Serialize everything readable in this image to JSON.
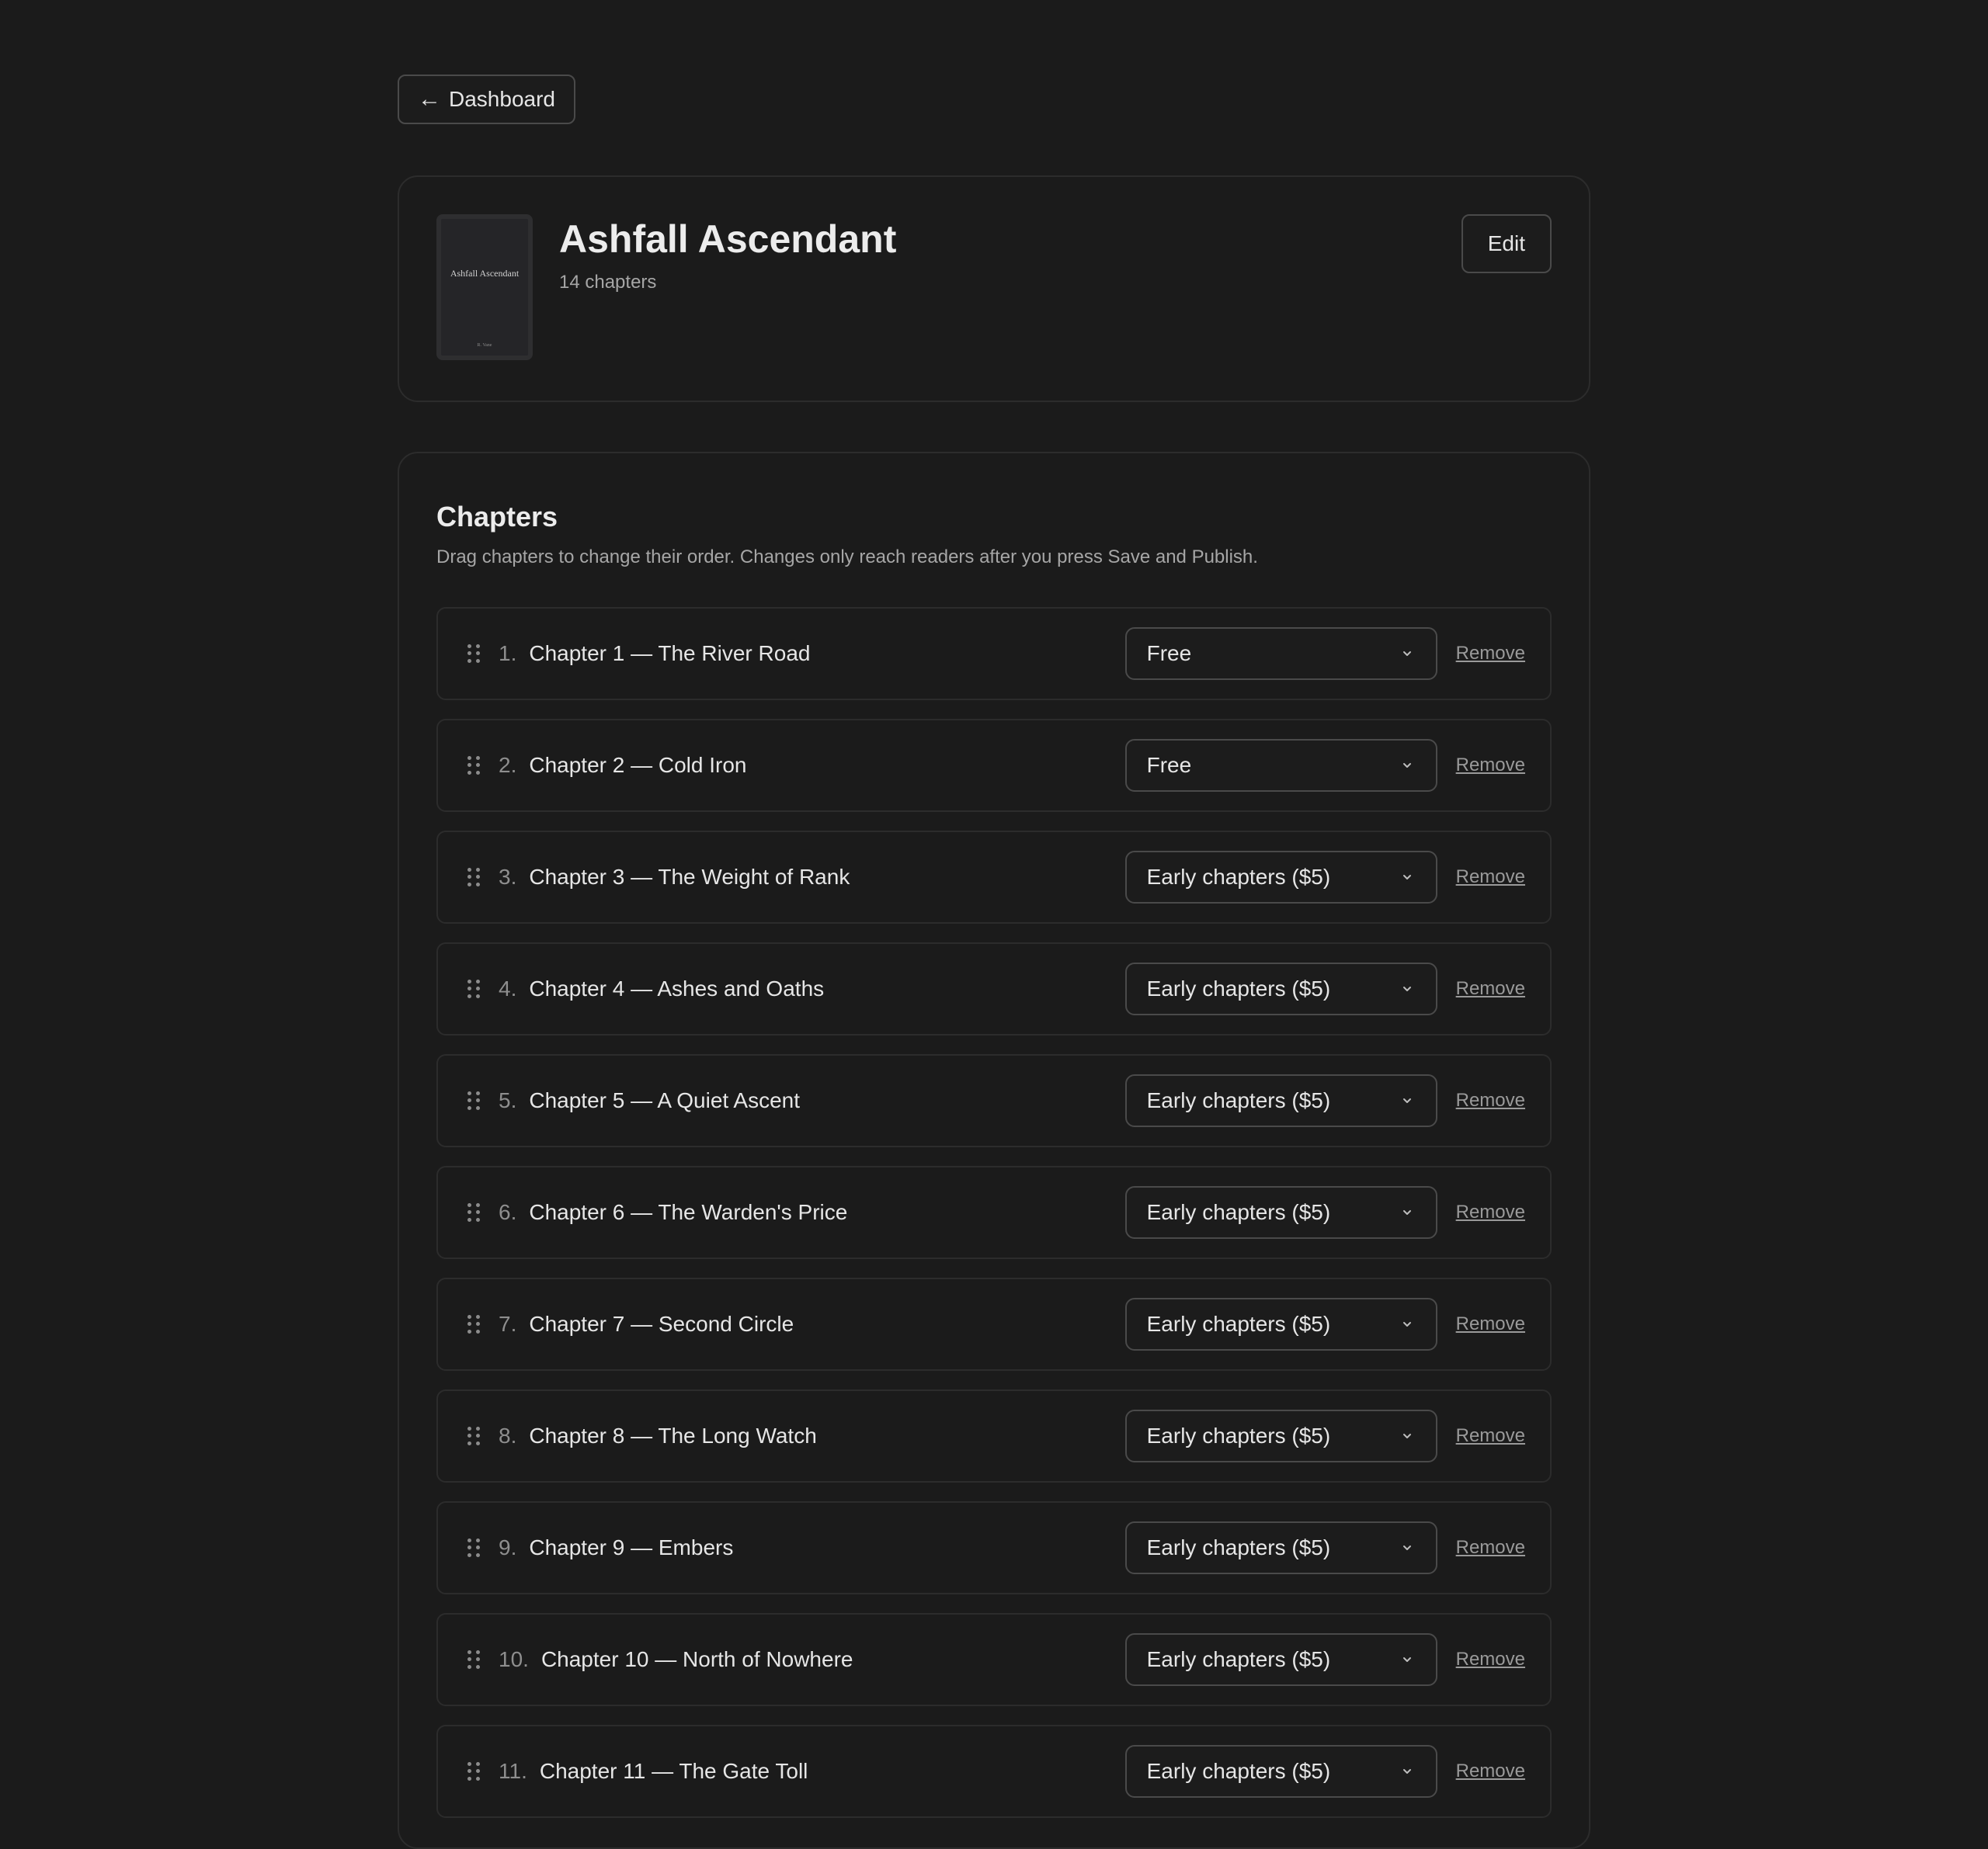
{
  "nav": {
    "back_label": "Dashboard",
    "back_icon": "←"
  },
  "book": {
    "title": "Ashfall Ascendant",
    "chapter_count": "14 chapters",
    "cover_title": "Ashfall Ascendant",
    "cover_author": "R. Vane",
    "edit_label": "Edit"
  },
  "chapters_section": {
    "title": "Chapters",
    "description": "Drag chapters to change their order. Changes only reach readers after you press Save and Publish.",
    "remove_label": "Remove",
    "items": [
      {
        "number": "1.",
        "title": "Chapter 1 — The River Road",
        "tier": "Free"
      },
      {
        "number": "2.",
        "title": "Chapter 2 — Cold Iron",
        "tier": "Free"
      },
      {
        "number": "3.",
        "title": "Chapter 3 — The Weight of Rank",
        "tier": "Early chapters ($5)"
      },
      {
        "number": "4.",
        "title": "Chapter 4 — Ashes and Oaths",
        "tier": "Early chapters ($5)"
      },
      {
        "number": "5.",
        "title": "Chapter 5 — A Quiet Ascent",
        "tier": "Early chapters ($5)"
      },
      {
        "number": "6.",
        "title": "Chapter 6 — The Warden's Price",
        "tier": "Early chapters ($5)"
      },
      {
        "number": "7.",
        "title": "Chapter 7 — Second Circle",
        "tier": "Early chapters ($5)"
      },
      {
        "number": "8.",
        "title": "Chapter 8 — The Long Watch",
        "tier": "Early chapters ($5)"
      },
      {
        "number": "9.",
        "title": "Chapter 9 — Embers",
        "tier": "Early chapters ($5)"
      },
      {
        "number": "10.",
        "title": "Chapter 10 — North of Nowhere",
        "tier": "Early chapters ($5)"
      },
      {
        "number": "11.",
        "title": "Chapter 11 — The Gate Toll",
        "tier": "Early chapters ($5)"
      }
    ]
  },
  "colors": {
    "background": "#1b1b1b",
    "border": "#2c2c2c",
    "text": "#e8e8e8",
    "muted": "#a6a6a6"
  }
}
